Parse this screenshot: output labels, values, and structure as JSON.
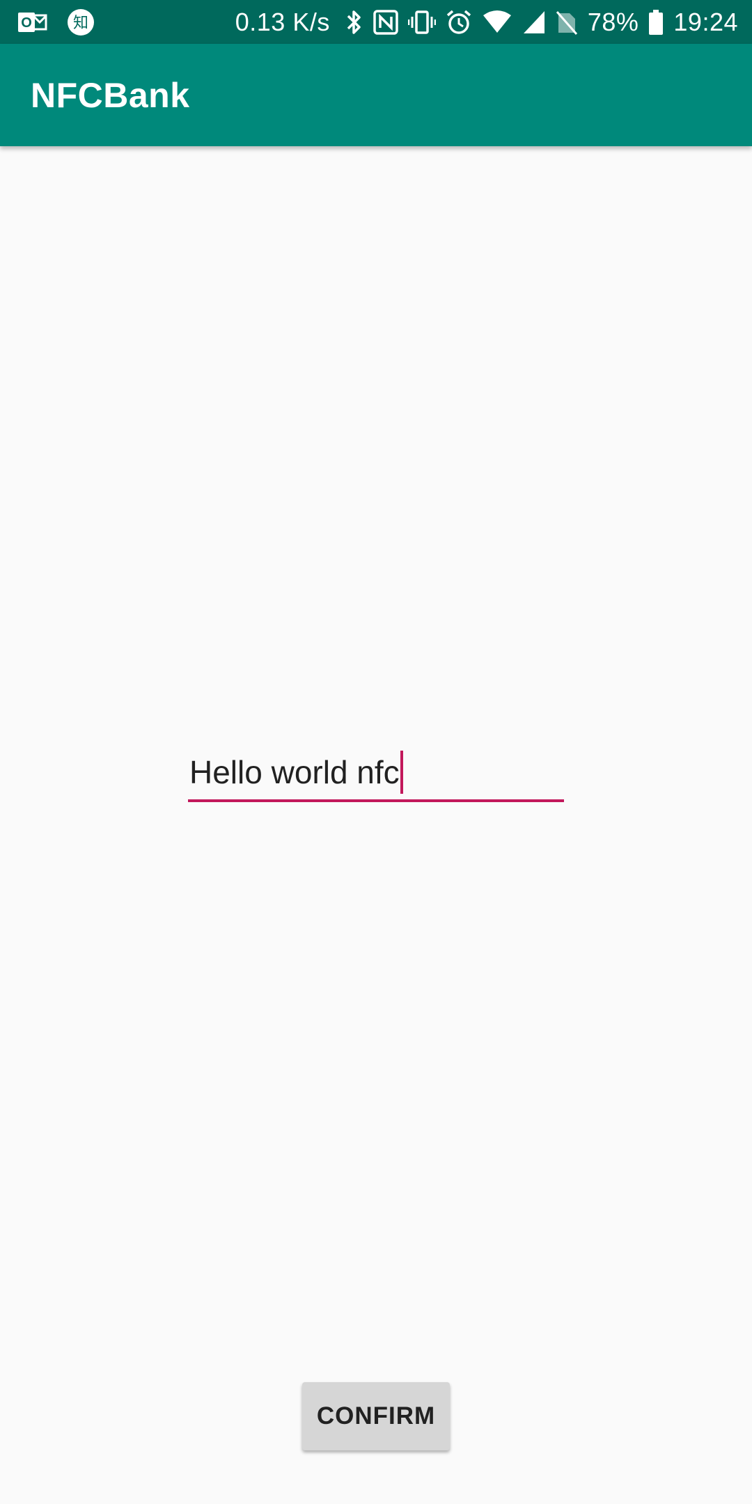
{
  "status_bar": {
    "net_speed": "0.13 K/s",
    "battery_percent": "78%",
    "time": "19:24",
    "left_icons": [
      "outlook-icon",
      "zhihu-icon"
    ],
    "left_icon_text": {
      "zhihu": "知"
    },
    "right_icons": [
      "bluetooth-icon",
      "nfc-icon",
      "vibrate-icon",
      "alarm-icon",
      "wifi-icon",
      "cell-signal-icon",
      "no-sim-icon",
      "battery-icon"
    ],
    "colors": {
      "background": "#00695c",
      "foreground": "#ffffff"
    }
  },
  "app_bar": {
    "title": "NFCBank",
    "color": "#00897b"
  },
  "input": {
    "value": "Hello world nfc",
    "accent_color": "#c2185b"
  },
  "confirm_button": {
    "label": "CONFIRM"
  }
}
